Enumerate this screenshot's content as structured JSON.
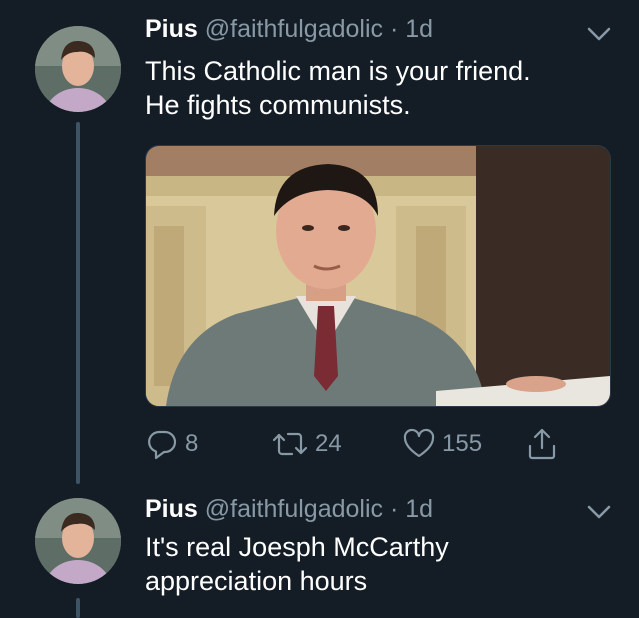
{
  "tweets": [
    {
      "name": "Pius",
      "handle": "@faithfulgadolic",
      "separator": "·",
      "time": "1d",
      "text_lines": [
        "This Catholic man is your friend.",
        "He fights communists."
      ],
      "replies": "8",
      "retweets": "24",
      "likes": "155",
      "image_alt": "Colorized photo of a man in a grey suit seated in front of an ornate fireplace"
    },
    {
      "name": "Pius",
      "handle": "@faithfulgadolic",
      "separator": "·",
      "time": "1d",
      "text_lines": [
        "It's real Joesph McCarthy",
        "appreciation hours"
      ]
    }
  ],
  "colors": {
    "background": "#141d26",
    "secondary_text": "#8899a6",
    "thread_line": "#3d5466"
  },
  "icons": [
    "reply-icon",
    "retweet-icon",
    "like-icon",
    "share-icon",
    "chevron-down-icon"
  ]
}
